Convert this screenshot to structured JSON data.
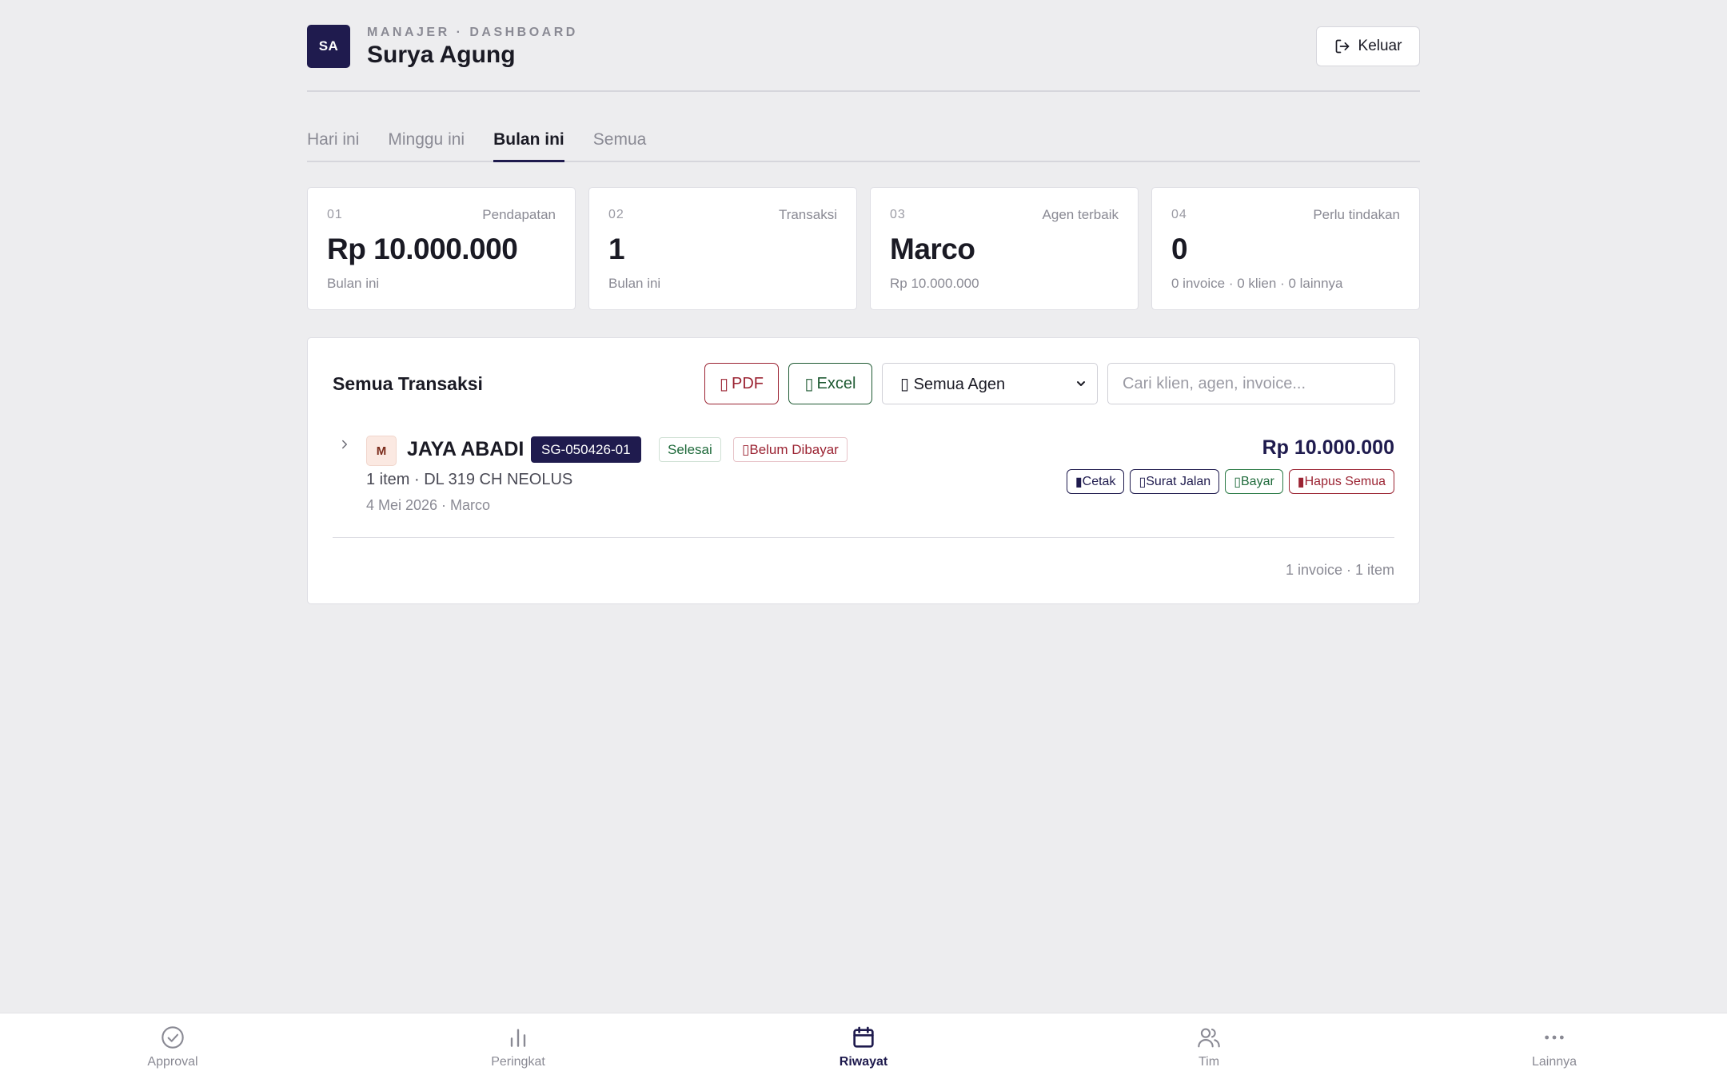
{
  "header": {
    "avatar_initials": "SA",
    "eyebrow": "MANAJER · DASHBOARD",
    "user_name": "Surya Agung",
    "logout_label": "Keluar"
  },
  "tabs": [
    {
      "label": "Hari ini",
      "active": false
    },
    {
      "label": "Minggu ini",
      "active": false
    },
    {
      "label": "Bulan ini",
      "active": true
    },
    {
      "label": "Semua",
      "active": false
    }
  ],
  "stats": [
    {
      "num": "01",
      "label": "Pendapatan",
      "value": "Rp 10.000.000",
      "sub": "Bulan ini"
    },
    {
      "num": "02",
      "label": "Transaksi",
      "value": "1",
      "sub": "Bulan ini"
    },
    {
      "num": "03",
      "label": "Agen terbaik",
      "value": "Marco",
      "sub": "Rp 10.000.000"
    },
    {
      "num": "04",
      "label": "Perlu tindakan",
      "value": "0",
      "sub": "0 invoice · 0 klien · 0 lainnya"
    }
  ],
  "transactions": {
    "title": "Semua Transaksi",
    "pdf_label": "PDF",
    "excel_label": "Excel",
    "agent_filter": "Semua Agen",
    "search_placeholder": "Cari klien, agen, invoice...",
    "rows": [
      {
        "agent_initial": "M",
        "client": "JAYA ABADI",
        "invoice": "SG-050426-01",
        "status": "Selesai",
        "payment": "Belum Dibayar",
        "items": "1 item · DL 319 CH NEOLUS",
        "meta": "4 Mei 2026 · Marco",
        "amount": "Rp 10.000.000",
        "actions": {
          "print": "Cetak",
          "delivery": "Surat Jalan",
          "pay": "Bayar",
          "delete_all": "Hapus Semua"
        }
      }
    ],
    "footer": "1 invoice · 1 item"
  },
  "bottom_nav": [
    {
      "label": "Approval",
      "icon": "check-circle-icon",
      "active": false
    },
    {
      "label": "Peringkat",
      "icon": "bar-chart-icon",
      "active": false
    },
    {
      "label": "Riwayat",
      "icon": "calendar-icon",
      "active": true
    },
    {
      "label": "Tim",
      "icon": "users-icon",
      "active": false
    },
    {
      "label": "Lainnya",
      "icon": "more-horizontal-icon",
      "active": false
    }
  ],
  "colors": {
    "brand": "#1f1b4e",
    "danger": "#9b2332",
    "success": "#1f6a3b",
    "background": "#ededef"
  }
}
